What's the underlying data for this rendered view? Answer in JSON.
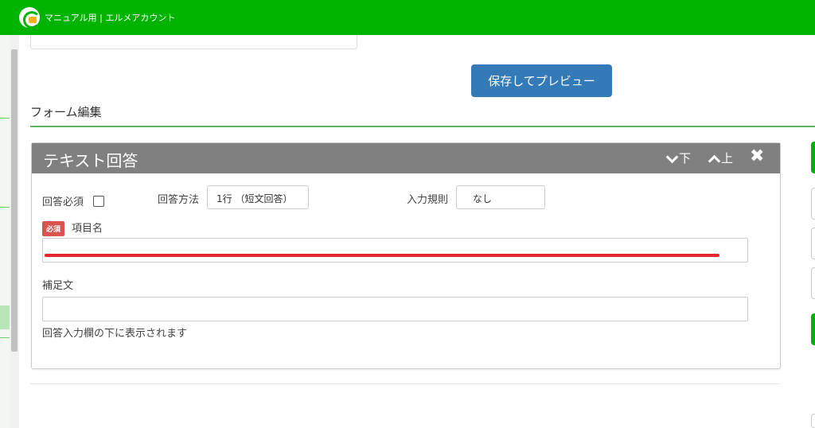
{
  "topbar": {
    "account_name": "マニュアル用 | エルメアカウント",
    "logo_icon": "lmessage-logo-icon",
    "color": "#00b300"
  },
  "toolbar": {
    "preview_label": "保存してプレビュー",
    "preview_color": "#337ab7"
  },
  "section": {
    "title": "フォーム編集"
  },
  "question_card": {
    "title": "テキスト回答",
    "move_down_label": "下",
    "move_up_label": "上",
    "required_label": "回答必須",
    "answer_method_label": "回答方法",
    "answer_method_value": "1行 （短文回答）",
    "input_rule_label": "入力規則",
    "input_rule_value": "なし",
    "required_badge": "必須",
    "item_name_label": "項目名",
    "item_name_value": "",
    "supplement_label": "補足文",
    "supplement_value": "",
    "supplement_help": "回答入力欄の下に表示されます",
    "header_color": "#808080",
    "badge_color": "#d9534f",
    "highlight_color": "#e8242b"
  }
}
